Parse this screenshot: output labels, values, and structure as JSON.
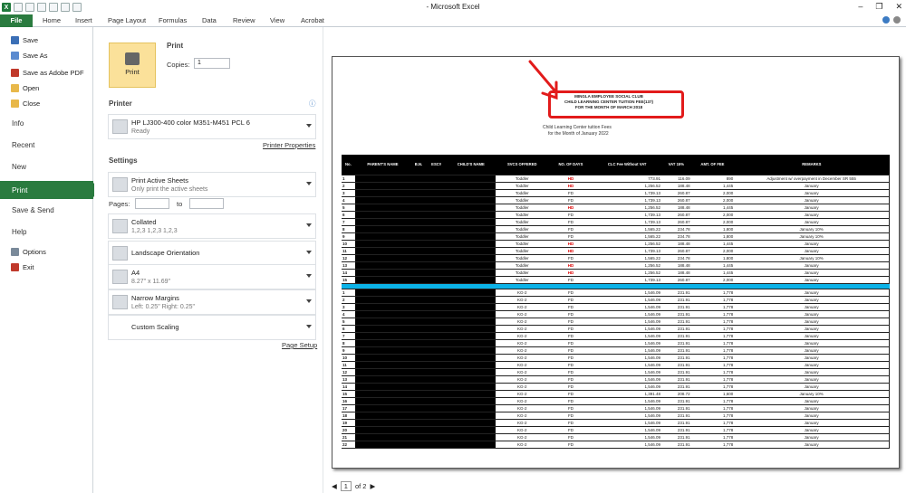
{
  "window": {
    "title": "- Microsoft Excel"
  },
  "ribbon": {
    "file": "File",
    "tabs": [
      "Home",
      "Insert",
      "Page Layout",
      "Formulas",
      "Data",
      "Review",
      "View",
      "Acrobat"
    ]
  },
  "backstage": {
    "items": [
      "Save",
      "Save As",
      "Save as Adobe PDF",
      "Open",
      "Close"
    ],
    "big_items": [
      "Info",
      "Recent",
      "New",
      "Print",
      "Save & Send",
      "Help"
    ],
    "small_items": [
      "Options",
      "Exit"
    ]
  },
  "print": {
    "section_title": "Print",
    "copies_label": "Copies:",
    "copies_value": "1",
    "print_button": "Print",
    "printer_heading": "Printer",
    "printer_name": "HP LJ300-400 color M351-M451 PCL 6",
    "printer_status": "Ready",
    "printer_properties": "Printer Properties",
    "settings_heading": "Settings",
    "active_sheets": "Print Active Sheets",
    "active_sheets_desc": "Only print the active sheets",
    "pages_label": "Pages:",
    "to_label": "to",
    "collated": "Collated",
    "collated_desc": "1,2,3   1,2,3   1,2,3",
    "orientation": "Landscape Orientation",
    "paper": "A4",
    "paper_desc": "8.27\" x 11.69\"",
    "margins": "Narrow Margins",
    "margins_desc": "Left: 0.25\"   Right: 0.25\"",
    "scaling": "Custom Scaling",
    "page_setup": "Page Setup"
  },
  "preview": {
    "header_lines": [
      "MINGLA EMPLOYEE SOCIAL CLUB",
      "CHILD LEARNING CENTER TUITION FEE(137)",
      "FOR THE MONTH OF MARCH 2018"
    ],
    "subtitle1": "Child Learning Center tuition Fees",
    "subtitle2": "for the Month of January 2022",
    "columns": [
      "No.",
      "PARENT'S NAME",
      "B.N.",
      "ESC#",
      "CHILD'S NAME",
      "SVCS OFFERED",
      "NO. OF DAYS",
      "CLC Fee Without VAT",
      "VAT 15%",
      "AMT. OF FEE",
      "REMARKS"
    ],
    "group1": [
      [
        "1",
        "Toddler",
        "HD",
        "773.91",
        "116.09",
        "890",
        "Adjustment w/ overpayment in December SR 555"
      ],
      [
        "2",
        "Toddler",
        "HD",
        "1,256.52",
        "188.48",
        "1,445",
        "January"
      ],
      [
        "3",
        "Toddler",
        "FD",
        "1,739.13",
        "260.87",
        "2,000",
        "January"
      ],
      [
        "4",
        "Toddler",
        "FD",
        "1,739.13",
        "260.87",
        "2,000",
        "January"
      ],
      [
        "5",
        "Toddler",
        "HD",
        "1,256.52",
        "188.48",
        "1,445",
        "January"
      ],
      [
        "6",
        "Toddler",
        "FD",
        "1,739.13",
        "260.87",
        "2,000",
        "January"
      ],
      [
        "7",
        "Toddler",
        "FD",
        "1,739.13",
        "260.87",
        "2,000",
        "January"
      ],
      [
        "8",
        "Toddler",
        "FD",
        "1,565.22",
        "234.78",
        "1,800",
        "January 10%"
      ],
      [
        "9",
        "Toddler",
        "FD",
        "1,565.22",
        "234.78",
        "1,800",
        "January 10%"
      ],
      [
        "10",
        "Toddler",
        "HD",
        "1,256.52",
        "188.48",
        "1,445",
        "January"
      ],
      [
        "11",
        "Toddler",
        "HD",
        "1,739.13",
        "260.87",
        "2,000",
        "January"
      ],
      [
        "12",
        "Toddler",
        "FD",
        "1,565.22",
        "234.78",
        "1,800",
        "January 10%"
      ],
      [
        "13",
        "Toddler",
        "HD",
        "1,256.52",
        "188.48",
        "1,445",
        "January"
      ],
      [
        "14",
        "Toddler",
        "HD",
        "1,256.52",
        "188.48",
        "1,445",
        "January"
      ],
      [
        "15",
        "Toddler",
        "FD",
        "1,739.13",
        "260.87",
        "2,000",
        "January"
      ]
    ],
    "group2": [
      [
        "1",
        "KG-2",
        "FD",
        "1,546.09",
        "231.91",
        "1,778",
        "January"
      ],
      [
        "2",
        "KG-2",
        "FD",
        "1,546.09",
        "231.91",
        "1,778",
        "January"
      ],
      [
        "3",
        "KG-2",
        "FD",
        "1,546.09",
        "231.91",
        "1,778",
        "January"
      ],
      [
        "4",
        "KG-2",
        "FD",
        "1,546.09",
        "231.91",
        "1,778",
        "January"
      ],
      [
        "5",
        "KG-2",
        "FD",
        "1,546.09",
        "231.91",
        "1,778",
        "January"
      ],
      [
        "6",
        "KG-2",
        "FD",
        "1,546.09",
        "231.91",
        "1,778",
        "January"
      ],
      [
        "7",
        "KG-2",
        "FD",
        "1,546.09",
        "231.91",
        "1,778",
        "January"
      ],
      [
        "8",
        "KG-2",
        "FD",
        "1,546.09",
        "231.91",
        "1,778",
        "January"
      ],
      [
        "9",
        "KG-2",
        "FD",
        "1,546.09",
        "231.91",
        "1,778",
        "January"
      ],
      [
        "10",
        "KG-2",
        "FD",
        "1,546.09",
        "231.91",
        "1,778",
        "January"
      ],
      [
        "11",
        "KG-2",
        "FD",
        "1,546.09",
        "231.91",
        "1,778",
        "January"
      ],
      [
        "12",
        "KG-2",
        "FD",
        "1,546.09",
        "231.91",
        "1,778",
        "January"
      ],
      [
        "13",
        "KG-2",
        "FD",
        "1,546.09",
        "231.91",
        "1,778",
        "January"
      ],
      [
        "14",
        "KG-2",
        "FD",
        "1,546.09",
        "231.91",
        "1,778",
        "January"
      ],
      [
        "15",
        "KG-2",
        "FD",
        "1,391.48",
        "208.72",
        "1,600",
        "January 10%"
      ],
      [
        "16",
        "KG-2",
        "FD",
        "1,546.09",
        "231.91",
        "1,778",
        "January"
      ],
      [
        "17",
        "KG-2",
        "FD",
        "1,546.09",
        "231.91",
        "1,778",
        "January"
      ],
      [
        "18",
        "KG-2",
        "FD",
        "1,546.09",
        "231.91",
        "1,778",
        "January"
      ],
      [
        "19",
        "KG-2",
        "FD",
        "1,546.09",
        "231.91",
        "1,778",
        "January"
      ],
      [
        "20",
        "KG-2",
        "FD",
        "1,546.09",
        "231.91",
        "1,778",
        "January"
      ],
      [
        "21",
        "KG-2",
        "FD",
        "1,546.09",
        "231.91",
        "1,778",
        "January"
      ],
      [
        "22",
        "KG-2",
        "FD",
        "1,546.09",
        "231.91",
        "1,778",
        "January"
      ]
    ]
  },
  "status": {
    "page": "1",
    "of": "of 2"
  },
  "colors": {
    "accent": "#2a7b3f",
    "annotation": "#e21b1b",
    "highlight_row": "#0cb3e8"
  }
}
